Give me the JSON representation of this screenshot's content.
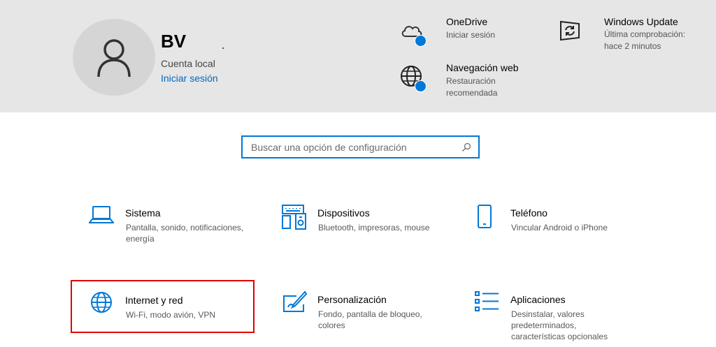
{
  "account": {
    "initials": "BV",
    "type": "Cuenta local",
    "sign_in_link": "Iniciar sesión"
  },
  "header_items": {
    "onedrive": {
      "title": "OneDrive",
      "sub": "Iniciar sesión",
      "icon": "cloud-icon"
    },
    "windows_update": {
      "title": "Windows Update",
      "sub1": "Última comprobación:",
      "sub2": "hace 2 minutos",
      "icon": "refresh-icon"
    },
    "web_browsing": {
      "title": "Navegación web",
      "sub1": "Restauración",
      "sub2": "recomendada",
      "icon": "globe-icon"
    }
  },
  "search": {
    "placeholder": "Buscar una opción de configuración",
    "value": ""
  },
  "categories": [
    {
      "title": "Sistema",
      "sub1": "Pantalla, sonido, notificaciones,",
      "sub2": "energía",
      "icon": "laptop-icon"
    },
    {
      "title": "Dispositivos",
      "sub1": "Bluetooth, impresoras, mouse",
      "icon": "devices-icon"
    },
    {
      "title": "Teléfono",
      "sub1": "Vincular Android o iPhone",
      "icon": "phone-icon"
    },
    {
      "title": "Internet y red",
      "sub1": "Wi-Fi, modo avión, VPN",
      "icon": "globe-icon"
    },
    {
      "title": "Personalización",
      "sub1": "Fondo, pantalla de bloqueo,",
      "sub2": "colores",
      "icon": "paint-icon"
    },
    {
      "title": "Aplicaciones",
      "sub1": "Desinstalar, valores",
      "sub2": "predeterminados,",
      "sub3": "características opcionales",
      "icon": "apps-list-icon"
    }
  ],
  "colors": {
    "accent": "#0078d7",
    "link": "#0067c0",
    "header_bg": "#e6e6e6",
    "highlight": "#e20000"
  }
}
